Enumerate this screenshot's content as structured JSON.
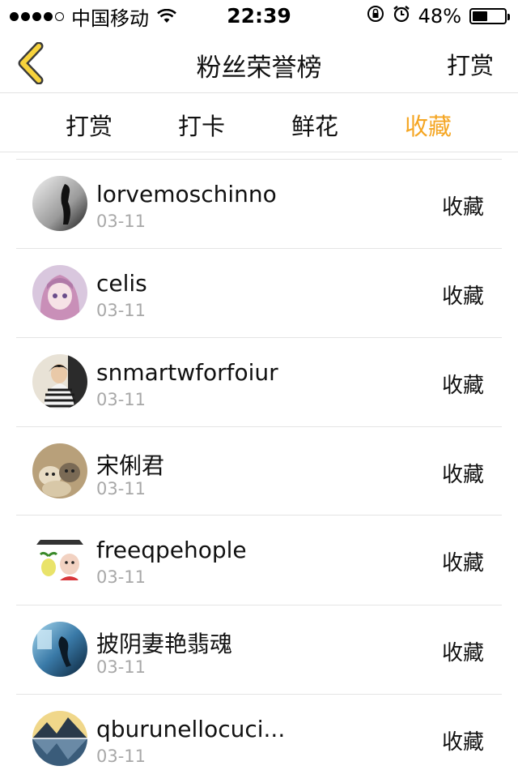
{
  "status_bar": {
    "carrier": "中国移动",
    "time": "22:39",
    "battery_percent_text": "48%",
    "battery_level": 0.48,
    "signal_bars_filled": 4,
    "signal_bars_total": 5
  },
  "nav": {
    "title": "粉丝荣誉榜",
    "action_label": "打赏",
    "accent_color": "#f5a623"
  },
  "tabs": [
    {
      "label": "打赏",
      "active": false
    },
    {
      "label": "打卡",
      "active": false
    },
    {
      "label": "鲜花",
      "active": false
    },
    {
      "label": "收藏",
      "active": true
    }
  ],
  "fans": [
    {
      "name": "lorvemoschinno",
      "date": "03-11",
      "action": "收藏",
      "avatar": "avatar-grey-silhouette"
    },
    {
      "name": "celis",
      "date": "03-11",
      "action": "收藏",
      "avatar": "avatar-anime-girl"
    },
    {
      "name": "snmartwforfoiur",
      "date": "03-11",
      "action": "收藏",
      "avatar": "avatar-striped-person"
    },
    {
      "name": "宋俐君",
      "date": "03-11",
      "action": "收藏",
      "avatar": "avatar-cats"
    },
    {
      "name": "freeqpehople",
      "date": "03-11",
      "action": "收藏",
      "avatar": "avatar-meme-sticker"
    },
    {
      "name": "披阴妻艳翡魂",
      "date": "03-11",
      "action": "收藏",
      "avatar": "avatar-blue-figure"
    },
    {
      "name": "qburunellocuci...",
      "date": "03-11",
      "action": "收藏",
      "avatar": "avatar-landscape"
    }
  ]
}
